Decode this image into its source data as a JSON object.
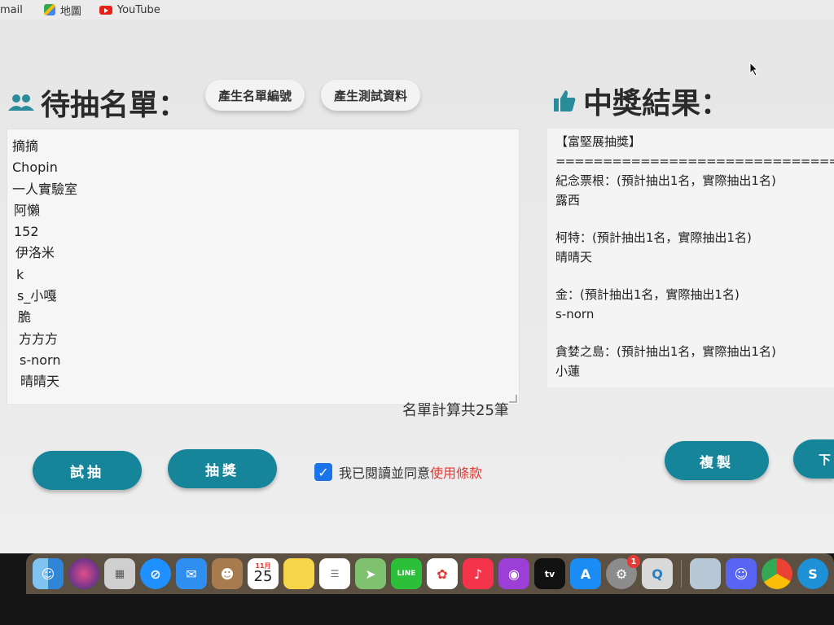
{
  "bookmarks": [
    {
      "label": "mail",
      "icon": "mail-icon"
    },
    {
      "label": "地圖",
      "icon": "maps-icon"
    },
    {
      "label": "YouTube",
      "icon": "youtube-icon"
    }
  ],
  "left_panel": {
    "title": "待抽名單：",
    "icon": "people-icon",
    "buttons": {
      "generate_ids": "產生名單編號",
      "generate_test": "產生測試資料"
    },
    "entries": [
      "摘摘",
      "Chopin",
      "一人實驗室",
      "阿懶",
      "152",
      "伊洛米",
      "k",
      "s_小嘎",
      "脆",
      "方方方",
      "s-norn",
      "晴晴天"
    ],
    "count_text": "名單計算共25筆"
  },
  "right_panel": {
    "title": "中獎結果：",
    "icon": "thumbs-up-icon",
    "heading": "【富堅展抽獎】",
    "separator": "==============================",
    "groups": [
      {
        "prize": "紀念票根：(預計抽出1名，實際抽出1名)",
        "winner": "露西"
      },
      {
        "prize": "柯特：(預計抽出1名，實際抽出1名)",
        "winner": "晴晴天"
      },
      {
        "prize": "金：(預計抽出1名，實際抽出1名)",
        "winner": "s-norn"
      },
      {
        "prize": "貪婪之島：(預計抽出1名，實際抽出1名)",
        "winner": "小蓮"
      }
    ]
  },
  "actions": {
    "trial": "試抽",
    "draw": "抽獎",
    "agree_text": "我已閱讀並同意",
    "terms_link": "使用條款",
    "agree_checked": true,
    "copy": "複製",
    "next_partial": "下"
  },
  "dock": {
    "calendar_month": "11月",
    "calendar_day": "25",
    "settings_badge": "1",
    "line_label": "LINE",
    "tv_label": "tv"
  },
  "colors": {
    "accent": "#16859a",
    "terms_link": "#e53935",
    "checkbox": "#1a73e8"
  }
}
